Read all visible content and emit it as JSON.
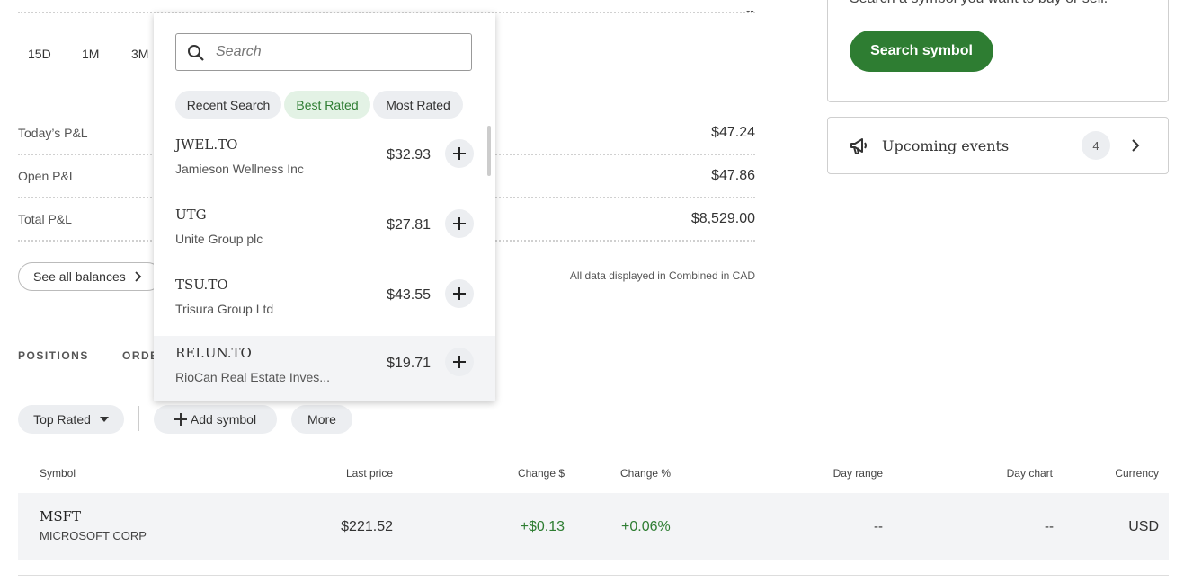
{
  "top_placeholder": "--",
  "range_buttons": [
    "15D",
    "1M",
    "3M"
  ],
  "pnl": [
    {
      "label": "Today’s P&L",
      "value": "$47.24"
    },
    {
      "label": "Open P&L",
      "value": "$47.86"
    },
    {
      "label": "Total P&L",
      "value": "$8,529.00"
    }
  ],
  "see_all_balances": "See all balances",
  "data_note": "All data displayed in Combined in CAD",
  "tabs": {
    "positions": "POSITIONS",
    "orders": "ORDE"
  },
  "toolbar": {
    "top_rated": "Top Rated",
    "add_symbol": "Add symbol",
    "more": "More"
  },
  "table": {
    "headers": [
      "Symbol",
      "Last price",
      "Change $",
      "Change %",
      "Day range",
      "Day chart",
      "Currency"
    ],
    "rows": [
      {
        "symbol": "MSFT",
        "name": "MICROSOFT CORP",
        "last_price": "$221.52",
        "change": "+$0.13",
        "change_pct": "+0.06%",
        "day_range": "--",
        "day_chart": "--",
        "currency": "USD"
      }
    ]
  },
  "search_card": {
    "text": "Search a symbol you want to buy or sell.",
    "button": "Search symbol"
  },
  "events": {
    "label": "Upcoming events",
    "count": "4"
  },
  "dropdown": {
    "search_placeholder": "Search",
    "filters": [
      "Recent Search",
      "Best Rated",
      "Most Rated"
    ],
    "active_filter": "Best Rated",
    "items": [
      {
        "symbol": "JWEL.TO",
        "name": "Jamieson Wellness Inc",
        "price": "$32.93"
      },
      {
        "symbol": "UTG",
        "name": "Unite Group plc",
        "price": "$27.81"
      },
      {
        "symbol": "TSU.TO",
        "name": "Trisura Group Ltd",
        "price": "$43.55"
      },
      {
        "symbol": "REI.UN.TO",
        "name": "RioCan Real Estate Inves...",
        "price": "$19.71"
      }
    ]
  },
  "colors": {
    "green": "#2e7d32",
    "chip_active_bg": "#e3f2e5",
    "pill_bg": "#eceef1",
    "row_bg": "#f3f4f6"
  },
  "icons": [
    "search-icon",
    "plus-icon",
    "chevron-right-icon",
    "caret-down-icon",
    "megaphone-icon"
  ]
}
